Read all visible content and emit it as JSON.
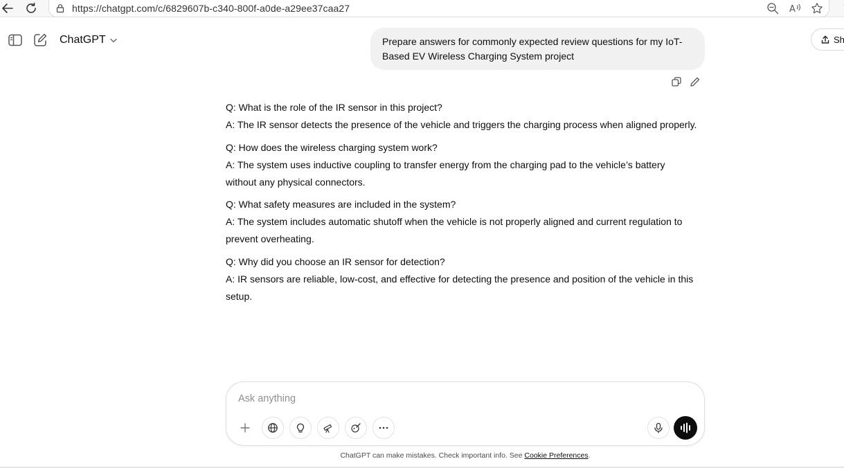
{
  "browser": {
    "url": "https://chatgpt.com/c/6829607b-c340-800f-a0de-a29ee37caa27"
  },
  "header": {
    "model_name": "ChatGPT",
    "share_label": "Sh"
  },
  "conversation": {
    "user_message": "Prepare answers for commonly expected review questions for my IoT-Based EV Wireless Charging System project",
    "assistant_qa": [
      {
        "q": "Q: What is the role of the IR sensor in this project?",
        "a": "A: The IR sensor detects the presence of the vehicle and triggers the charging process when aligned properly."
      },
      {
        "q": "Q: How does the wireless charging system work?",
        "a": "A: The system uses inductive coupling to transfer energy from the charging pad to the vehicle’s battery without any physical connectors."
      },
      {
        "q": "Q: What safety measures are included in the system?",
        "a": "A: The system includes automatic shutoff when the vehicle is not properly aligned and current regulation to prevent overheating."
      },
      {
        "q": "Q: Why did you choose an IR sensor for detection?",
        "a": "A: IR sensors are reliable, low-cost, and effective for detecting the presence and position of the vehicle in this setup."
      }
    ]
  },
  "composer": {
    "placeholder": "Ask anything"
  },
  "footer": {
    "note": "ChatGPT can make mistakes. Check important info. See ",
    "link": "Cookie Preferences",
    "end": "."
  }
}
